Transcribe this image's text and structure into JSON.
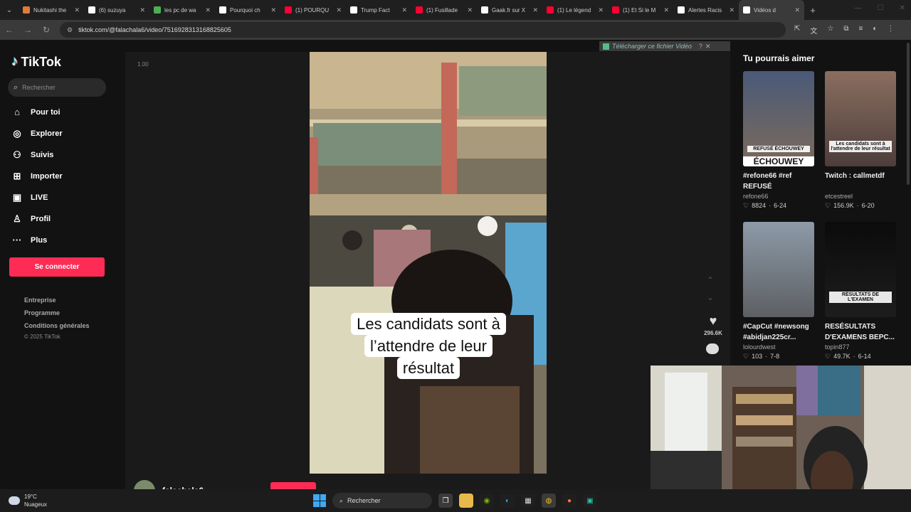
{
  "browser": {
    "tabs": [
      {
        "label": "Nukitashi the",
        "color": "#e07b39"
      },
      {
        "label": "(6) suzuya",
        "color": "#ffffff"
      },
      {
        "label": "les pc de wa",
        "color": "#4caf50"
      },
      {
        "label": "Pourquoi ch",
        "color": "#ffffff"
      },
      {
        "label": "(1) POURQU",
        "color": "#ff0033"
      },
      {
        "label": "Trump Fact",
        "color": "#ffffff"
      },
      {
        "label": "(1) Fusillade",
        "color": "#ff0033"
      },
      {
        "label": "Gaak.fr sur X",
        "color": "#ffffff"
      },
      {
        "label": "(1) Le légend",
        "color": "#ff0033"
      },
      {
        "label": "(1) Et Si le M",
        "color": "#ff0033"
      },
      {
        "label": "Alertes Racis",
        "color": "#ffffff"
      },
      {
        "label": "Vidéos d",
        "color": "#ffffff"
      }
    ],
    "url": "tiktok.com/@falachala6/video/7516928313168825605"
  },
  "sidebar": {
    "logo": "TikTok",
    "search_placeholder": "Rechercher",
    "nav": [
      {
        "label": "Pour toi",
        "icon": "home-icon",
        "glyph": "⌂"
      },
      {
        "label": "Explorer",
        "icon": "compass-icon",
        "glyph": "◎"
      },
      {
        "label": "Suivis",
        "icon": "users-icon",
        "glyph": "⚇"
      },
      {
        "label": "Importer",
        "icon": "upload-icon",
        "glyph": "⊞"
      },
      {
        "label": "LIVE",
        "icon": "live-icon",
        "glyph": "▣"
      },
      {
        "label": "Profil",
        "icon": "profile-icon",
        "glyph": "♙"
      },
      {
        "label": "Plus",
        "icon": "more-icon",
        "glyph": "···"
      }
    ],
    "login_button": "Se connecter",
    "footer_links": [
      "Entreprise",
      "Programme",
      "Conditions générales"
    ],
    "copyright": "© 2025 TikTok"
  },
  "video": {
    "speed": "1.00",
    "caption_lines": [
      "Les candidats sont à",
      "l’attendre de leur",
      "résultat"
    ],
    "likes": "296.6K",
    "author": "falachala6",
    "download_bar": "Télécharger ce fichier Vidéo"
  },
  "recommendations": {
    "title": "Tu pourrais aimer",
    "items": [
      {
        "title": "#refone66 #ref REFUSÉ ÉCHOUWEY",
        "user": "refone66",
        "likes": "8824",
        "date": "6-24",
        "overlay": "REFUSÉ ÉCHOUWEY",
        "overlay2": "ÉCHOUWEY",
        "colors": [
          "#4a5a78",
          "#7d6a5b"
        ]
      },
      {
        "title": "Twitch : callmetdf",
        "user": "etcestreel",
        "likes": "156.9K",
        "date": "6-20",
        "overlay": "Les candidats sont à l'attendre de leur résultat",
        "overlay2": "",
        "colors": [
          "#8a6e60",
          "#4d3d3a"
        ]
      },
      {
        "title": "#CapCut #newsong #abidjan225cr...",
        "user": "lolourdwest",
        "likes": "103",
        "date": "7-8",
        "overlay": "",
        "overlay2": "",
        "colors": [
          "#8d9aa8",
          "#5d5f63"
        ]
      },
      {
        "title": "RESÉSULTATS D'EXAMENS BEPC...",
        "user": "topin877",
        "likes": "49.7K",
        "date": "6-14",
        "overlay": "RÉSULTATS DE L'EXAMEN",
        "overlay2": "",
        "colors": [
          "#0b0b0b",
          "#1d1d1d"
        ]
      }
    ]
  },
  "taskbar": {
    "temperature": "19°C",
    "weather": "Nuageux",
    "search": "Rechercher"
  }
}
